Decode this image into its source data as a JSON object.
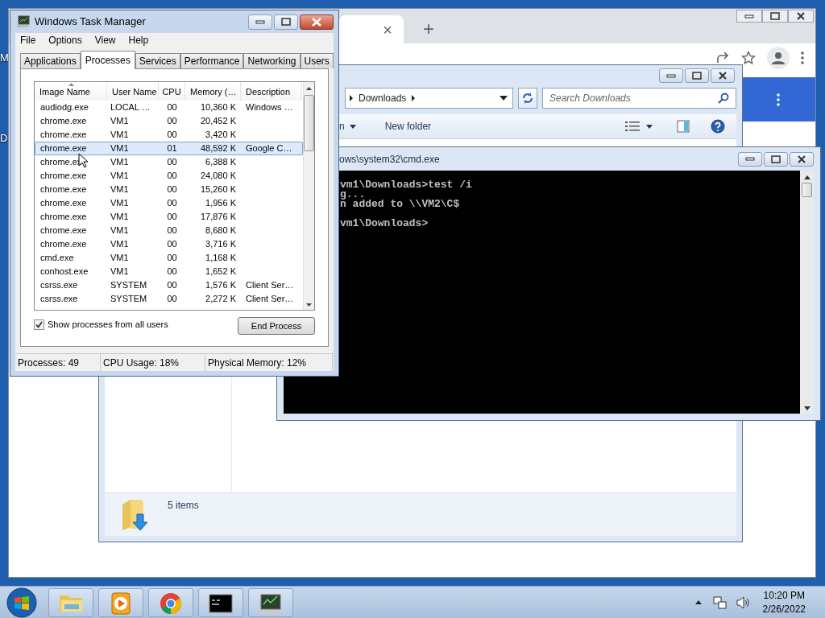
{
  "desktop": {
    "icon_labels": [
      "M",
      "D"
    ]
  },
  "browser": {
    "tab_close": "×",
    "new_tab": "+"
  },
  "explorer": {
    "breadcrumb": "Downloads",
    "search": {
      "placeholder": "Search Downloads"
    },
    "toolbar": {
      "organize": "n",
      "new_folder": "New folder"
    },
    "status": "5 items"
  },
  "console": {
    "title": "ows\\system32\\cmd.exe",
    "lines": [
      "vm1\\Downloads>test /i",
      "g...",
      "n added to \\\\VM2\\C$"
    ],
    "prompt": "vm1\\Downloads>"
  },
  "task_manager": {
    "title": "Windows Task Manager",
    "menu": [
      "File",
      "Options",
      "View",
      "Help"
    ],
    "tabs": [
      {
        "label": "Applications",
        "selected": false
      },
      {
        "label": "Processes",
        "selected": true
      },
      {
        "label": "Services",
        "selected": false
      },
      {
        "label": "Performance",
        "selected": false
      },
      {
        "label": "Networking",
        "selected": false
      },
      {
        "label": "Users",
        "selected": false
      }
    ],
    "columns": [
      {
        "label": "Image Name",
        "sorted": true
      },
      {
        "label": "User Name",
        "sorted": false
      },
      {
        "label": "CPU",
        "sorted": false
      },
      {
        "label": "Memory (…",
        "sorted": false
      },
      {
        "label": "Description",
        "sorted": false
      }
    ],
    "rows": [
      {
        "cells": [
          "audiodg.exe",
          "LOCAL …",
          "00",
          "10,360 K",
          "Windows …"
        ],
        "selected": false
      },
      {
        "cells": [
          "chrome.exe",
          "VM1",
          "00",
          "20,452 K",
          ""
        ],
        "selected": false
      },
      {
        "cells": [
          "chrome.exe",
          "VM1",
          "00",
          "3,420 K",
          ""
        ],
        "selected": false
      },
      {
        "cells": [
          "chrome.exe",
          "VM1",
          "01",
          "48,592 K",
          "Google C…"
        ],
        "selected": true
      },
      {
        "cells": [
          "chrome.ex",
          "VM1",
          "00",
          "6,388 K",
          ""
        ],
        "selected": false
      },
      {
        "cells": [
          "chrome.exe",
          "VM1",
          "00",
          "24,080 K",
          ""
        ],
        "selected": false
      },
      {
        "cells": [
          "chrome.exe",
          "VM1",
          "00",
          "15,260 K",
          ""
        ],
        "selected": false
      },
      {
        "cells": [
          "chrome.exe",
          "VM1",
          "00",
          "1,956 K",
          ""
        ],
        "selected": false
      },
      {
        "cells": [
          "chrome.exe",
          "VM1",
          "00",
          "17,876 K",
          ""
        ],
        "selected": false
      },
      {
        "cells": [
          "chrome.exe",
          "VM1",
          "00",
          "8,680 K",
          ""
        ],
        "selected": false
      },
      {
        "cells": [
          "chrome.exe",
          "VM1",
          "00",
          "3,716 K",
          ""
        ],
        "selected": false
      },
      {
        "cells": [
          "cmd.exe",
          "VM1",
          "00",
          "1,168 K",
          ""
        ],
        "selected": false
      },
      {
        "cells": [
          "conhost.exe",
          "VM1",
          "00",
          "1,652 K",
          ""
        ],
        "selected": false
      },
      {
        "cells": [
          "csrss.exe",
          "SYSTEM",
          "00",
          "1,576 K",
          "Client Ser…"
        ],
        "selected": false
      },
      {
        "cells": [
          "csrss.exe",
          "SYSTEM",
          "00",
          "2,272 K",
          "Client Ser…"
        ],
        "selected": false
      }
    ],
    "show_all_users": {
      "label": "Show processes from all users",
      "checked": true
    },
    "end_process": "End Process",
    "status_bar": [
      "Processes: 49",
      "CPU Usage: 18%",
      "Physical Memory: 12%"
    ]
  },
  "taskbar": {
    "apps": [
      {
        "kind": "explorer"
      },
      {
        "kind": "media"
      },
      {
        "kind": "chrome"
      },
      {
        "kind": "console"
      },
      {
        "kind": "taskmgr"
      }
    ],
    "clock": {
      "time": "10:20 PM",
      "date": "2/26/2022"
    }
  }
}
